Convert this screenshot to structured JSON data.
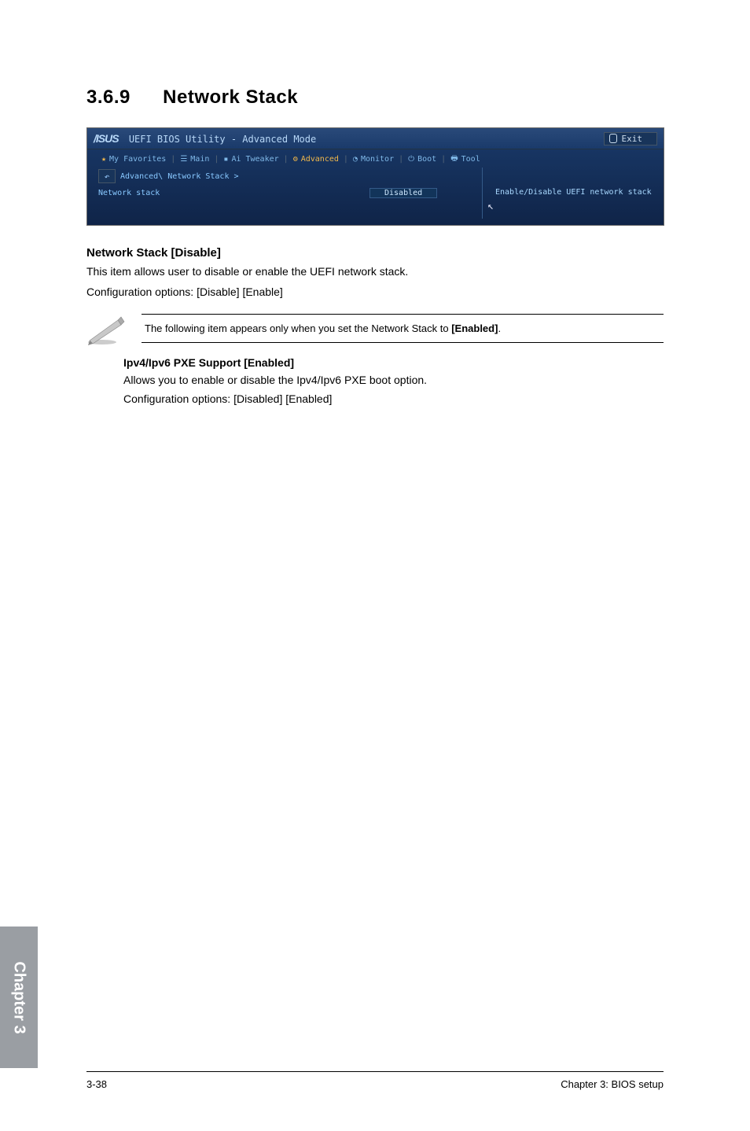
{
  "section": {
    "number": "3.6.9",
    "title": "Network Stack"
  },
  "bios": {
    "windowTitle": "UEFI BIOS Utility - Advanced Mode",
    "logo": "/ISUS",
    "exit": "Exit",
    "tabs": {
      "fav": "My Favorites",
      "main": "Main",
      "ai": "Ai Tweaker",
      "advanced": "Advanced",
      "monitor": "Monitor",
      "boot": "Boot",
      "tool": "Tool"
    },
    "breadcrumb": "Advanced\\ Network Stack >",
    "row": {
      "label": "Network stack",
      "value": "Disabled"
    },
    "help": "Enable/Disable UEFI network stack"
  },
  "content": {
    "h1": "Network Stack [Disable]",
    "p1": "This item allows user to disable or enable the UEFI network stack.",
    "p2": "Configuration options: [Disable] [Enable]",
    "notePrefix": "The following item appears only when you set the Network Stack to ",
    "noteBold": "[Enabled]",
    "noteSuffix": ".",
    "h2": "Ipv4/Ipv6 PXE Support [Enabled]",
    "p3": "Allows you to enable or disable the Ipv4/Ipv6 PXE boot option.",
    "p4": "Configuration options: [Disabled] [Enabled]"
  },
  "sideTab": "Chapter 3",
  "footer": {
    "left": "3-38",
    "right": "Chapter 3: BIOS setup"
  }
}
